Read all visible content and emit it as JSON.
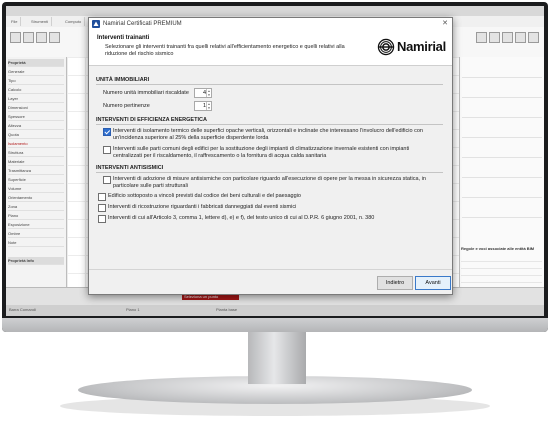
{
  "dialog": {
    "title": "Namirial Certificati PREMIUM",
    "close_glyph": "✕",
    "step_title": "Interventi trainanti",
    "step_description": "Selezionare gli interventi trainanti fra quelli relativi all'efficientamento energetico e quelli relativi alla riduzione del rischio sismico",
    "brand_name": "Namirial",
    "sections": {
      "unita": {
        "title": "UNITÀ IMMOBILIARI",
        "fields": [
          {
            "label": "Numero unità immobiliari riscaldate",
            "value": "4"
          },
          {
            "label": "Numero pertinenze",
            "value": "1"
          }
        ]
      },
      "efficienza": {
        "title": "INTERVENTI DI EFFICIENZA ENERGETICA",
        "options": [
          {
            "label": "Interventi di isolamento termico delle superfici opache verticali, orizzontali e inclinate che interessano l'involucro dell'edificio con un'incidenza superiore al 25% della superficie disperdente lorda",
            "checked": true
          },
          {
            "label": "Interventi sulle parti comuni degli edifici per la sostituzione degli impianti di climatizzazione invernale esistenti con impianti centralizzati per il riscaldamento, il raffrescamento o la fornitura di acqua calda sanitaria",
            "checked": false
          }
        ]
      },
      "antisismici": {
        "title": "INTERVENTI ANTISISMICI",
        "options": [
          {
            "label": "Interventi di adozione di misure antisismiche con particolare riguardo all'esecuzione di opere per la messa in sicurezza statica, in particolare sulle parti strutturali",
            "checked": false
          }
        ]
      }
    },
    "extra_options": [
      {
        "label": "Edificio sottoposto a vincoli previsti dal codice dei beni culturali e del paesaggio",
        "checked": false
      },
      {
        "label": "Interventi di ricostruzione riguardanti i fabbricati danneggiati dal eventi sismici",
        "checked": false
      },
      {
        "label": "Interventi di cui all'Articolo 3, comma 1, lettere d), e) e f), del testo unico di cui al D.P.R. 6 giugno 2001, n. 380",
        "checked": false
      }
    ],
    "buttons": {
      "back": "Indietro",
      "next": "Avanti"
    }
  },
  "background_app": {
    "tabs": [
      "File",
      "Strumenti",
      "Computo",
      "Architettura",
      "Impianti",
      "Involucro",
      "Verifiche",
      "Elementi",
      "Stampa",
      "Dati",
      "Documentazione",
      "Materiali",
      "Vista",
      "Aiuto"
    ],
    "panel_title": "Proprietà",
    "panel_rows": [
      "Generale",
      "Tipo",
      "Calcolo",
      "Layer",
      "Dimensioni",
      "Spessore",
      "Altezza",
      "Quota",
      "Isolamento",
      "Struttura",
      "Materiale",
      "Trasmittanza",
      "Superficie",
      "Volume",
      "Orientamento",
      "Zona",
      "Piano",
      "Esposizione",
      "Ombre",
      "Note",
      "Proprietà Info"
    ],
    "bim_panel_title": "Regole e voci associate alle entità BIM",
    "status_text": "Seleziona un punto",
    "bottom_labels": [
      "Barra Comandi",
      "Piano 1",
      "Pianta base"
    ]
  },
  "colors": {
    "accent_blue": "#2f6fcf",
    "brand_red": "#a51717",
    "dialog_bg": "#f0f0f0"
  }
}
